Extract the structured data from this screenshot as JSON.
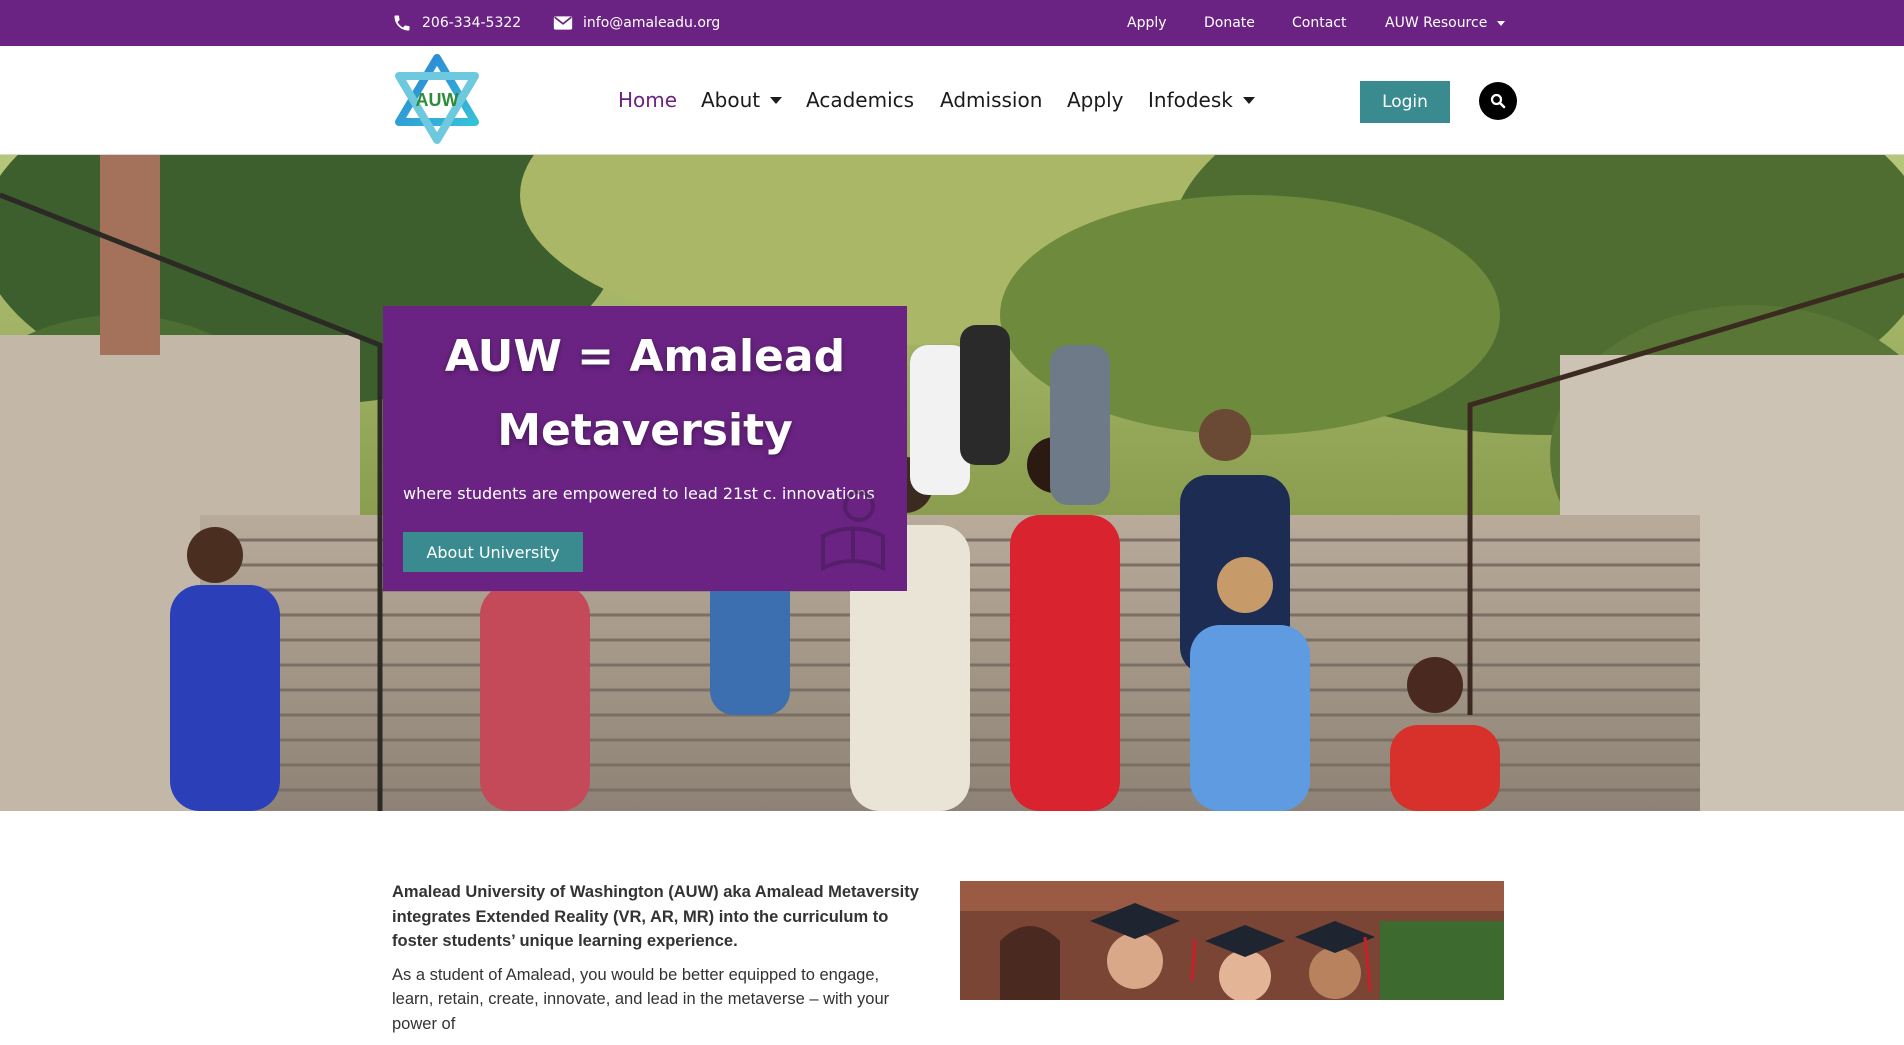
{
  "topbar": {
    "phone": "206-334-5322",
    "email": "info@amaleadu.org",
    "links": [
      {
        "label": "Apply"
      },
      {
        "label": "Donate"
      },
      {
        "label": "Contact"
      },
      {
        "label": "AUW Resource"
      }
    ],
    "background": "#6a2382"
  },
  "header": {
    "logo_text": "AUW",
    "nav": [
      {
        "label": "Home",
        "active": true
      },
      {
        "label": "About",
        "dropdown": true
      },
      {
        "label": "Academics"
      },
      {
        "label": "Admission"
      },
      {
        "label": "Apply"
      },
      {
        "label": "Infodesk",
        "dropdown": true
      }
    ],
    "login_label": "Login",
    "search_icon": "search-icon"
  },
  "hero": {
    "title_line1": "AUW = Amalead",
    "title_line2": "Metaversity",
    "subtitle": "where students are empowered to lead 21st c. innovations",
    "button_label": "About University",
    "card_color": "#6a2382",
    "button_color": "#3a8b90"
  },
  "intro": {
    "lead": "Amalead University of Washington (AUW) aka Amalead Metaversity integrates Extended Reality (VR, AR, MR) into the curriculum to foster students’ unique learning experience.",
    "body": "As a student of Amalead, you would be better equipped to engage, learn, retain, create, innovate, and lead in the metaverse – with your power of"
  }
}
